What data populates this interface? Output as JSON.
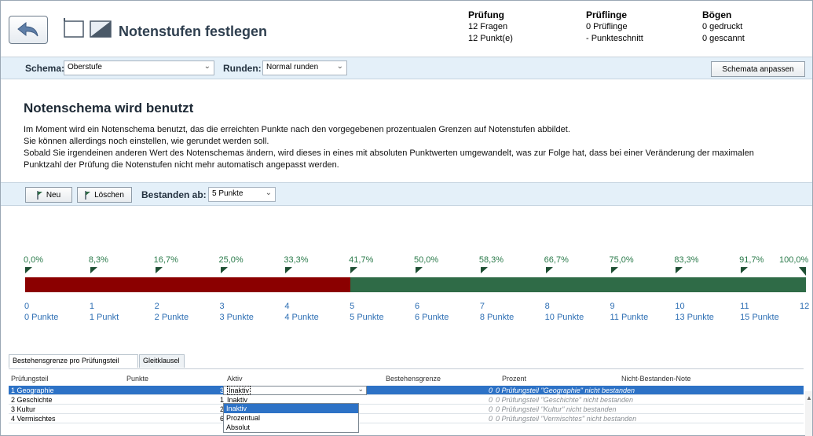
{
  "header": {
    "title": "Notenstufen festlegen",
    "pruefung": {
      "label": "Prüfung",
      "line1": "12 Fragen",
      "line2": "12 Punkt(e)"
    },
    "prueflinge": {
      "label": "Prüflinge",
      "line1": "0 Prüflinge",
      "line2": "- Punkteschnitt"
    },
    "boegen": {
      "label": "Bögen",
      "line1": "0 gedruckt",
      "line2": "0 gescannt"
    }
  },
  "toolbar1": {
    "schema_label": "Schema:",
    "schema_value": "Oberstufe",
    "runden_label": "Runden:",
    "runden_value": "Normal runden",
    "anpassen_button": "Schemata anpassen"
  },
  "info": {
    "title": "Notenschema wird benutzt",
    "line1": "Im Moment wird ein Notenschema benutzt, das die erreichten Punkte nach den vorgegebenen prozentualen Grenzen auf Notenstufen abbildet.",
    "line2": "Sie können allerdings noch einstellen, wie gerundet werden soll.",
    "line3": "Sobald Sie irgendeinen anderen Wert des Notenschemas ändern, wird dieses in eines mit absoluten Punktwerten umgewandelt, was zur Folge hat, dass bei einer Veränderung der maximalen",
    "line4": "Punktzahl der Prüfung die Notenstufen nicht mehr automatisch angepasst werden."
  },
  "toolbar2": {
    "neu_button": "Neu",
    "loeschen_button": "Löschen",
    "bestanden_label": "Bestanden ab:",
    "bestanden_value": "5 Punkte"
  },
  "scale": {
    "percent_labels": [
      "0,0%",
      "8,3%",
      "16,7%",
      "25,0%",
      "33,3%",
      "41,7%",
      "50,0%",
      "58,3%",
      "66,7%",
      "75,0%",
      "83,3%",
      "91,7%",
      "100,0%"
    ],
    "point_numbers": [
      "0",
      "1",
      "2",
      "3",
      "4",
      "5",
      "6",
      "7",
      "8",
      "9",
      "10",
      "11",
      "12"
    ],
    "point_labels": [
      "0 Punkte",
      "1 Punkt",
      "2 Punkte",
      "3 Punkte",
      "4 Punkte",
      "5 Punkte",
      "6 Punkte",
      "8 Punkte",
      "10 Punkte",
      "11 Punkte",
      "13 Punkte",
      "15 Punkte"
    ],
    "pass_from": 5,
    "max_points": 12,
    "fail_color": "#8b0000",
    "pass_color": "#2f6b47"
  },
  "tabs": {
    "tab1": "Bestehensgrenze pro Prüfungsteil",
    "tab2": "Gleitklausel"
  },
  "table": {
    "headers": {
      "teil": "Prüfungsteil",
      "punkte": "Punkte",
      "aktiv": "Aktiv",
      "grenze": "Bestehensgrenze",
      "prozent": "Prozent",
      "note": "Nicht-Bestanden-Note"
    },
    "rows": [
      {
        "teil": "1 Geographie",
        "punkte": "3",
        "aktiv": "Inaktiv",
        "prozent": "0",
        "note": "0 Prüfungsteil \"Geographie\" nicht bestanden"
      },
      {
        "teil": "2 Geschichte",
        "punkte": "1",
        "aktiv": "Inaktiv",
        "prozent": "0",
        "note": "0 Prüfungsteil \"Geschichte\" nicht bestanden"
      },
      {
        "teil": "3 Kultur",
        "punkte": "2",
        "aktiv": "Inaktiv",
        "prozent": "0",
        "note": "0 Prüfungsteil \"Kultur\" nicht bestanden"
      },
      {
        "teil": "4 Vermischtes",
        "punkte": "6",
        "aktiv": "Inaktiv",
        "prozent": "0",
        "note": "0 Prüfungsteil \"Vermischtes\" nicht bestanden"
      }
    ],
    "dropdown_options": [
      "Inaktiv",
      "Prozentual",
      "Absolut"
    ]
  }
}
